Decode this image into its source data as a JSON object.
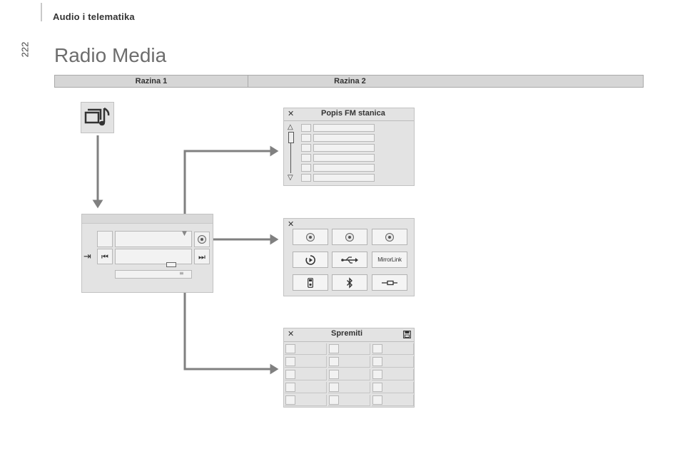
{
  "header": {
    "section_title": "Audio i telematika",
    "page_number": "222"
  },
  "page_title": "Radio Media",
  "levels": {
    "level1": "Razina 1",
    "level2": "Razina 2"
  },
  "fm_list": {
    "title": "Popis FM stanica",
    "close_icon": "close-icon",
    "row_count": 6
  },
  "media_sources": {
    "close_icon": "close-icon",
    "buttons": [
      "cd-icon",
      "cd-icon",
      "cd-icon",
      "play-icon",
      "usb-icon",
      "mirrorlink-logo",
      "ipod-icon",
      "bluetooth-icon",
      "aux-cable-icon"
    ],
    "mirrorlink_text": "MirrorLink"
  },
  "presets": {
    "title": "Spremiti",
    "close_icon": "close-icon",
    "save_icon": "save-icon",
    "rows": 5,
    "cols": 3
  },
  "colors": {
    "arrow": "#808080",
    "panel_bg": "#e3e3e3",
    "table_bg": "#d6d6d6"
  }
}
